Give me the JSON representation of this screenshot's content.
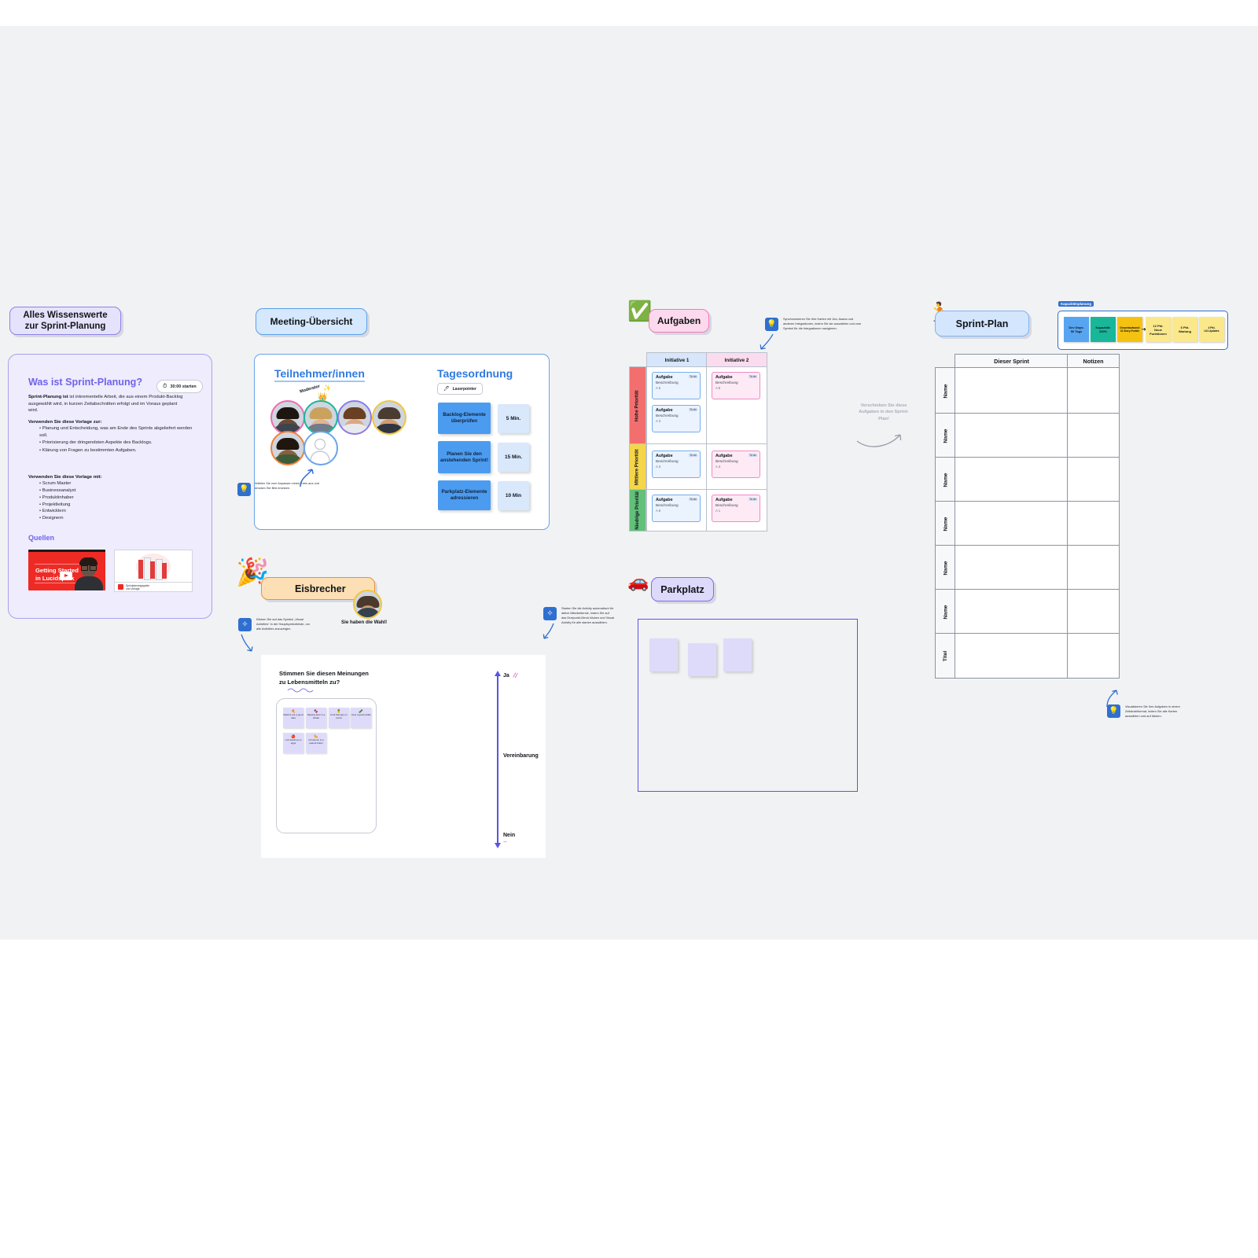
{
  "canvas": {
    "bg": "#f1f2f4"
  },
  "sections": {
    "knowledge": {
      "pill": "Alles Wissenswerte\nzur Sprint-Planung",
      "pill_line1": "Alles Wissenswerte",
      "pill_line2": "zur Sprint-Planung",
      "heading": "Was ist Sprint-Planung?",
      "timer": "30:00 starten",
      "intro_bold": "Sprint-Planung ist",
      "intro_rest": " ist inkrementelle Arbeit, die aus einem Produkt-Backlog ausgewählt wird, in kurzen Zeitabschnitten erfolgt und im Voraus geplant wird.",
      "use_for_title": "Verwenden Sie diese Vorlage zur:",
      "use_for": [
        "Planung und Entscheidung, was am Ende des Sprints abgeliefert werden soll.",
        "Priorisierung der dringendsten Aspekte des Backlogs.",
        "Klärung von Fragen zu bestimmten Aufgaben."
      ],
      "use_with_title": "Verwenden Sie diese Vorlage mit:",
      "use_with": [
        "Scrum Master",
        "Businessanalyst",
        "Produktinhaber",
        "Projektleitung",
        "Entwicklern",
        "Designern"
      ],
      "sources_title": "Quellen",
      "video_title_line1": "Getting Started",
      "video_title_line2": "in Lucidspark",
      "doc_caption": "Sprintplanungsguide",
      "doc_caption2": "und Vorlage"
    },
    "meeting": {
      "pill": "Meeting-Übersicht",
      "participants_title": "Teilnehmer/innen",
      "moderator_label": "Moderator",
      "participants_tip": "Wählen Sie zum Anpassen einen Kreis aus und drücken Sie Bild ersetzen.",
      "agenda_title": "Tagesordnung",
      "laserpointer": "Laserpointer",
      "agenda": [
        {
          "task": "Backlog-Elemente überprüfen",
          "time": "5 Min."
        },
        {
          "task": "Planen Sie den anstehenden Sprint!",
          "time": "15 Min."
        },
        {
          "task": "Parkplatz-Elemente adressieren",
          "time": "10 Min"
        }
      ]
    },
    "tasks": {
      "pill": "Aufgaben",
      "pill_icon": "check-mark-emoji",
      "tip": "Synchronisieren Sie Ihre Karten mit Jira, Asana und anderen Integrationen, indem Sie sie auswählen und zum Symbol für die Integrationen navigieren.",
      "move_note": "Verschieben Sie diese Aufgaben in den Sprint-Plan!",
      "columns": [
        "Initiative 1",
        "Initiative 2"
      ],
      "rows": [
        "Hohe Priorität",
        "Mittlere Priorität",
        "Niedrige Priorität"
      ],
      "card": {
        "title": "Aufgabe",
        "desc": "Beschreibung",
        "badge": "To do",
        "meta": "A  5"
      },
      "cells": [
        {
          "row": 0,
          "col": 0,
          "cards": [
            {
              "meta": "A  5"
            },
            {
              "meta": "A  3"
            }
          ]
        },
        {
          "row": 0,
          "col": 1,
          "cards": [
            {
              "meta": "A  8"
            }
          ]
        },
        {
          "row": 1,
          "col": 0,
          "cards": [
            {
              "meta": "A  3"
            }
          ]
        },
        {
          "row": 1,
          "col": 1,
          "cards": [
            {
              "meta": "A  3"
            }
          ]
        },
        {
          "row": 2,
          "col": 0,
          "cards": [
            {
              "meta": "A  8"
            }
          ]
        },
        {
          "row": 2,
          "col": 1,
          "cards": [
            {
              "meta": "A  1"
            }
          ]
        }
      ]
    },
    "sprintplan": {
      "pill": "Sprint-Plan",
      "pill_icon": "runner-emoji",
      "capacity_tag": "Kapazitätsplanung",
      "capacity_notes": [
        {
          "text": "Dev Days:\n50 Tage",
          "line1": "Dev Days:",
          "line2": "50 Tage",
          "color": "#57a5f0"
        },
        {
          "text": "Kapazität:\n100%",
          "line1": "Kapazität:",
          "line2": "100%",
          "color": "#19b79a"
        },
        {
          "text": "Gesamtaufwand:\n31 Story-Punkte",
          "line1": "Gesamtaufwand:",
          "line2": "31 Story-Punkte",
          "color": "#f5c211"
        },
        {
          "text": "12 Pkt.\nNeue Funktionen",
          "line1": "12 Pkt.",
          "line2": "Neue Funktionen",
          "color": "#fbe88b"
        },
        {
          "text": "6 Pkt.\nWartung",
          "line1": "6 Pkt.",
          "line2": "Wartung",
          "color": "#fbe88b"
        },
        {
          "text": "4 Pkt.\nUX-Updates",
          "line1": "4 Pkt.",
          "line2": "UX-Updates",
          "color": "#fbe88b"
        }
      ],
      "table_headers": [
        "Dieser Sprint",
        "Notizen"
      ],
      "row_labels": [
        "Name",
        "Name",
        "Name",
        "Name",
        "Name",
        "Name",
        "Titel"
      ],
      "tip": "Visualisieren Sie Ihre Aufgaben in einem Zeitstrahlformat, indem Sie alle Karten auswählen und auf klicken."
    },
    "icebreaker": {
      "pill": "Eisbrecher",
      "pill_icon": "party-popper-emoji",
      "caption": "Sie haben die Wahl!",
      "tip": "Klicken Sie auf das Symbol „Visual Activities“ in der Hauptsymbolleiste, um alle Activities anzuzeigen.",
      "question_line1": "Stimmen Sie diesen Meinungen",
      "question_line2": "zu Lebensmitteln zu?",
      "axis_top": "Ja",
      "axis_mid": "Vereinbarung",
      "axis_bottom": "Nein",
      "notes": [
        {
          "emoji": "🍕",
          "text": "Raisins are a  good idea"
        },
        {
          "emoji": "🍫",
          "text": "Dipping fries in a shake"
        },
        {
          "emoji": "🍍",
          "text": "Fruit belongs on pizza"
        },
        {
          "emoji": "🥒",
          "text": "I love a  good pickle"
        },
        {
          "emoji": "🍎",
          "text": "I put ketchup on eggs"
        },
        {
          "emoji": "🌭",
          "text": "Cinnamon is a  peanut butter"
        }
      ]
    },
    "parkplatz": {
      "pill": "Parkplatz",
      "pill_icon": "car-emoji",
      "tip": "Starten Sie die Activity automatisch für aktive Mitarbeitende, indem Sie auf das Dreipunkt-Menü klicken und Visual Activity für alle starten auswählen.",
      "notes_count": 3
    }
  }
}
